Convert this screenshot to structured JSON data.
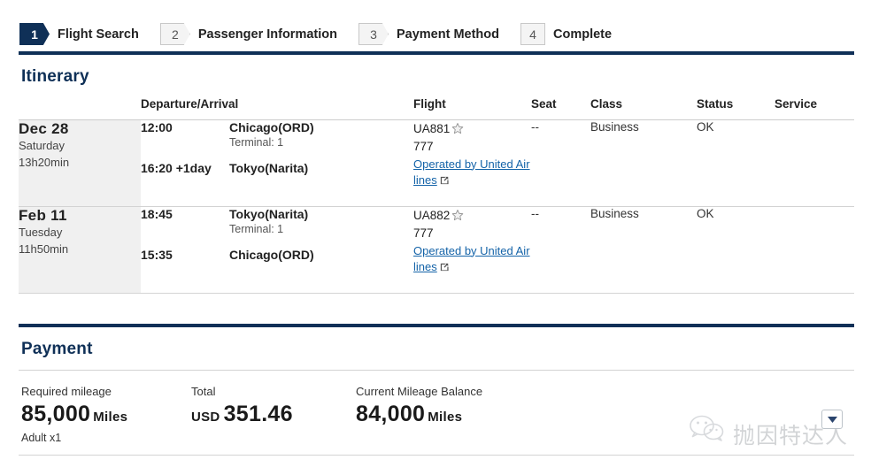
{
  "steps": [
    {
      "num": "1",
      "label": "Flight Search",
      "state": "active"
    },
    {
      "num": "2",
      "label": "Passenger Information",
      "state": "arrow"
    },
    {
      "num": "3",
      "label": "Payment Method",
      "state": "arrow"
    },
    {
      "num": "4",
      "label": "Complete",
      "state": "plain"
    }
  ],
  "itinerary": {
    "title": "Itinerary",
    "headers": {
      "date": "",
      "departure_arrival": "Departure/Arrival",
      "flight": "Flight",
      "seat": "Seat",
      "class": "Class",
      "status": "Status",
      "service": "Service"
    },
    "rows": [
      {
        "date_main": "Dec 28",
        "date_weekday": "Saturday",
        "duration": "13h20min",
        "depart_time": "12:00",
        "depart_place": "Chicago(ORD)",
        "terminal": "Terminal: 1",
        "arrive_time": "16:20",
        "arrive_day_offset": "+1day",
        "arrive_place": "Tokyo(Narita)",
        "flight_no": "UA881",
        "alliance_icon": "star-alliance-icon",
        "aircraft": "777",
        "operated_by": "Operated by United Airlines",
        "external_icon": "external-link-icon",
        "seat": "--",
        "class": "Business",
        "status": "OK",
        "service": ""
      },
      {
        "date_main": "Feb 11",
        "date_weekday": "Tuesday",
        "duration": "11h50min",
        "depart_time": "18:45",
        "depart_place": "Tokyo(Narita)",
        "terminal": "Terminal: 1",
        "arrive_time": "15:35",
        "arrive_day_offset": "",
        "arrive_place": "Chicago(ORD)",
        "flight_no": "UA882",
        "alliance_icon": "star-alliance-icon",
        "aircraft": "777",
        "operated_by": "Operated by United Airlines",
        "external_icon": "external-link-icon",
        "seat": "--",
        "class": "Business",
        "status": "OK",
        "service": ""
      }
    ]
  },
  "payment": {
    "title": "Payment",
    "required_mileage_label": "Required mileage",
    "required_mileage_value": "85,000",
    "required_mileage_unit": "Miles",
    "passenger_note": "Adult x1",
    "total_label": "Total",
    "total_currency": "USD",
    "total_value": "351.46",
    "balance_label": "Current Mileage Balance",
    "balance_value": "84,000",
    "balance_unit": "Miles"
  },
  "watermark": {
    "text": "抛因特达人",
    "logo_icon": "wechat-icon",
    "chevron_icon": "chevron-down-icon"
  },
  "colors": {
    "navy": "#0f3057",
    "link": "#1463a8",
    "row_bg": "#f0f0f0"
  }
}
